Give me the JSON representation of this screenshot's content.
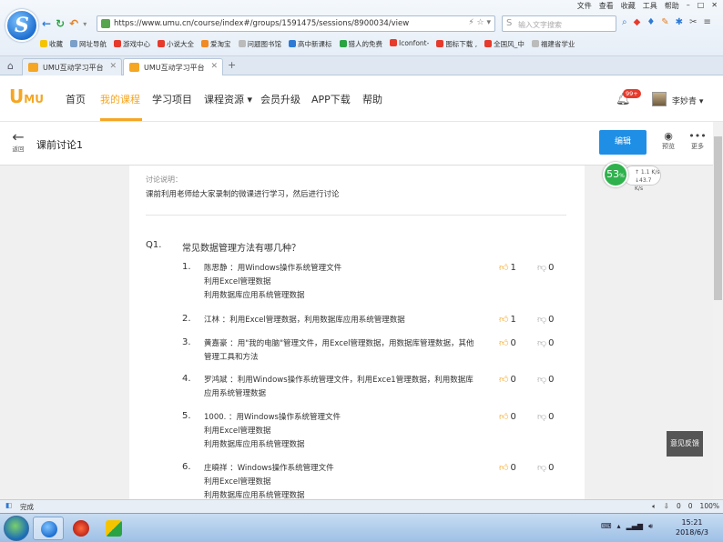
{
  "browser": {
    "top_menu": [
      "文件",
      "查看",
      "收藏",
      "工具",
      "帮助"
    ],
    "url": "https://www.umu.cn/course/index#/groups/1591475/sessions/8900034/view",
    "search_placeholder": "输入文字搜索",
    "bookmarks": [
      "收藏",
      "网址导航",
      "游戏中心",
      "小说大全",
      "爱淘宝",
      "问题图书馆",
      "高中新课标",
      "猎人的免费",
      "Iconfont-",
      "图标下载 ,",
      "全国风_中",
      "福建省学业"
    ],
    "tabs": [
      {
        "label": "UMU互动学习平台",
        "active": false
      },
      {
        "label": "UMU互动学习平台",
        "active": true
      }
    ],
    "newtab_label": "+"
  },
  "app": {
    "logo_text": "U",
    "logo_suffix": "MU",
    "nav": [
      {
        "label": "首页",
        "active": false
      },
      {
        "label": "我的课程",
        "active": true
      },
      {
        "label": "学习项目",
        "active": false
      },
      {
        "label": "课程资源 ▾",
        "active": false
      },
      {
        "label": "会员升级",
        "active": false
      },
      {
        "label": "APP下载",
        "active": false
      },
      {
        "label": "帮助",
        "active": false
      }
    ],
    "notification_count": "99+",
    "username": "李妙青 ▾",
    "accent_color": "#f5a623"
  },
  "subheader": {
    "back_label": "返回",
    "title": "课前讨论1",
    "edit_label": "编辑",
    "preview_label": "预览",
    "more_label": "更多"
  },
  "content": {
    "desc_label": "讨论说明：",
    "desc_text": "课前利用老师给大家录制的微课进行学习，然后进行讨论",
    "question_num": "Q1.",
    "question_text": "常见数据管理方法有哪几种？",
    "answers": [
      {
        "num": "1.",
        "text": "陈思静 ：用Windows操作系统管理文件\n利用Excel管理数据\n利用数据库应用系统管理数据",
        "likes": "1",
        "dislikes": "0"
      },
      {
        "num": "2.",
        "text": "江林 ：利用Excel管理数据，利用数据库应用系统管理数据",
        "likes": "1",
        "dislikes": "0"
      },
      {
        "num": "3.",
        "text": "黄嘉豪 ：用\"我的电脑\"管理文件，用Excel管理数据，用数据库管理数据，其他管理工具和方法",
        "likes": "0",
        "dislikes": "0"
      },
      {
        "num": "4.",
        "text": "罗鸿斌 ：利用Windows操作系统管理文件，利用Exce1管理数据，利用数据库应用系统管理数据",
        "likes": "0",
        "dislikes": "0"
      },
      {
        "num": "5.",
        "text": "1000. ：用Windows操作系统管理文件\n利用Excel管理数据\n利用数据库应用系统管理数据",
        "likes": "0",
        "dislikes": "0"
      },
      {
        "num": "6.",
        "text": "庄曉祥 ：Windows操作系统管理文件\n利用Excel管理数据\n利用数据库应用系统管理数据",
        "likes": "0",
        "dislikes": "0"
      }
    ]
  },
  "widgets": {
    "speed_value": "53",
    "speed_unit": "%",
    "upload": "↑ 1.1 K/s",
    "download": "↓43.7 K/s",
    "feedback_label": "意见反馈"
  },
  "statusbar": {
    "status": "完成",
    "right_items": [
      "0",
      "0",
      "100%"
    ]
  },
  "taskbar": {
    "time": "15:21",
    "date": "2018/6/3"
  }
}
